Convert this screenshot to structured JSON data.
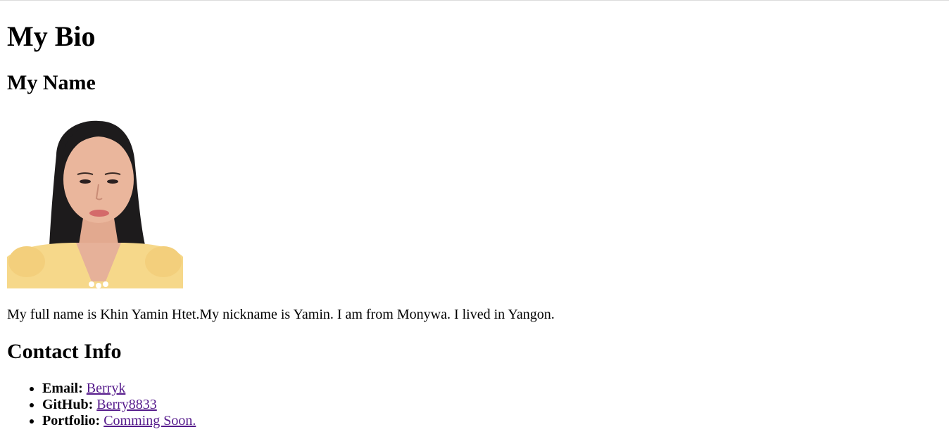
{
  "page": {
    "title": "My Bio",
    "name_heading": "My Name",
    "photo_label": "portrait photo",
    "bio_text": "My full name is Khin Yamin Htet.My nickname is Yamin. I am from Monywa. I lived in Yangon.",
    "contact_heading": "Contact Info"
  },
  "contact": [
    {
      "label": "Email:",
      "link_text": "Berryk"
    },
    {
      "label": "GitHub:",
      "link_text": "Berry8833"
    },
    {
      "label": "Portfolio:",
      "link_text": "Comming Soon."
    }
  ],
  "colors": {
    "link_visited": "#551a8b",
    "text": "#000000",
    "background": "#ffffff"
  }
}
